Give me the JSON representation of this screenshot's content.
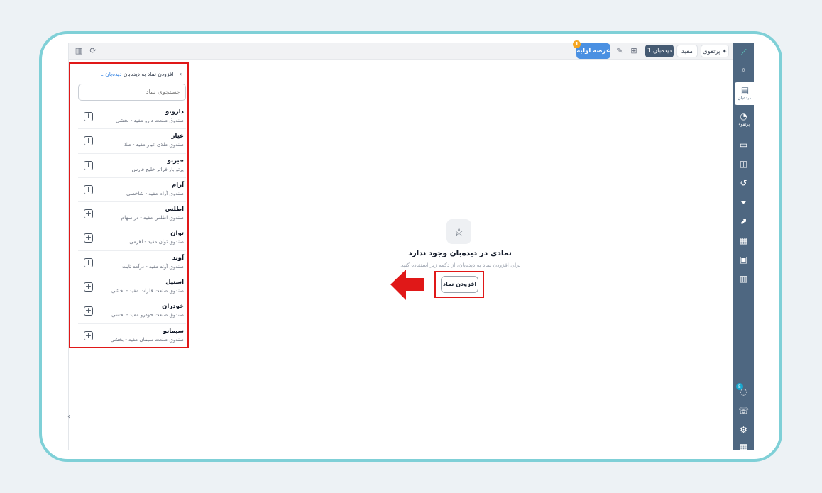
{
  "topbar": {
    "buttons": [
      {
        "id": "portfolio",
        "label": "پرتفوی",
        "icon": "pin-icon"
      },
      {
        "id": "mofid",
        "label": "مفید"
      },
      {
        "id": "watchlist1",
        "label": "دیده‌بان 1"
      },
      {
        "id": "ipo",
        "label": "عرضه اولیه",
        "badge": "1"
      }
    ]
  },
  "panel": {
    "title": "افزودن نماد به دیده‌بان",
    "title_link": "دیده‌بان 1",
    "search_placeholder": "جستجوی نماد",
    "items": [
      {
        "name": "دارونو",
        "desc": "صندوق صنعت دارو مفید - بخشی"
      },
      {
        "name": "عیار",
        "desc": "صندوق طلای عیار مفید - طلا"
      },
      {
        "name": "حیرتو",
        "desc": "پرتو بار فراتر خلیج فارس"
      },
      {
        "name": "آرام",
        "desc": "صندوق آرام مفید - شاخصی"
      },
      {
        "name": "اطلس",
        "desc": "صندوق اطلس مفید - در سهام"
      },
      {
        "name": "توان",
        "desc": "صندوق توان مفید - اهرمی"
      },
      {
        "name": "آوند",
        "desc": "صندوق آوند مفید - درآمد ثابت"
      },
      {
        "name": "استیل",
        "desc": "صندوق صنعت فلزات مفید - بخشی"
      },
      {
        "name": "خودران",
        "desc": "صندوق صنعت خودرو مفید - بخشی"
      },
      {
        "name": "سیمانو",
        "desc": "صندوق صنعت سیمان مفید - بخشی"
      }
    ]
  },
  "empty_state": {
    "title": "نمادی در دیده‌بان وجود ندارد",
    "subtitle": "برای افزودن نماد به دیده‌بان، از دکمه زیر استفاده کنید.",
    "button": "افزودن نماد"
  },
  "rail": {
    "items": [
      {
        "icon": "search-icon"
      },
      {
        "icon": "watchlist-icon",
        "label": "دیده‌بان"
      },
      {
        "icon": "portfolio-icon",
        "label": "پرتفوی"
      },
      {
        "icon": "option-icon"
      },
      {
        "icon": "basket-icon"
      },
      {
        "icon": "history-icon"
      },
      {
        "icon": "filter-icon"
      },
      {
        "icon": "chart-icon"
      },
      {
        "icon": "grid-icon"
      },
      {
        "icon": "report-icon"
      },
      {
        "icon": "analysis-icon"
      }
    ],
    "bottom": [
      {
        "icon": "chat-icon",
        "badge": "5"
      },
      {
        "icon": "support-icon"
      },
      {
        "icon": "settings-icon"
      }
    ]
  },
  "colors": {
    "accent_red": "#e01818",
    "rail": "#4e6781",
    "brand_blue": "#4a90e2",
    "frame": "#7fd0d7"
  }
}
